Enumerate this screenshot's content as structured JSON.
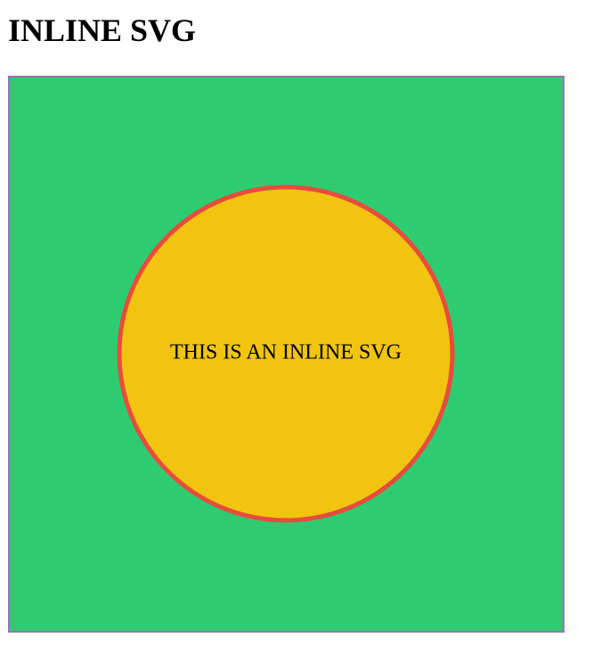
{
  "page": {
    "title": "INLINE SVG"
  },
  "svg_demo": {
    "label": "THIS IS AN INLINE SVG",
    "colors": {
      "background_fill": "#2ecc71",
      "background_border": "#9b72b8",
      "circle_fill": "#f1c40f",
      "circle_stroke": "#e74c3c",
      "text": "#000000"
    }
  }
}
